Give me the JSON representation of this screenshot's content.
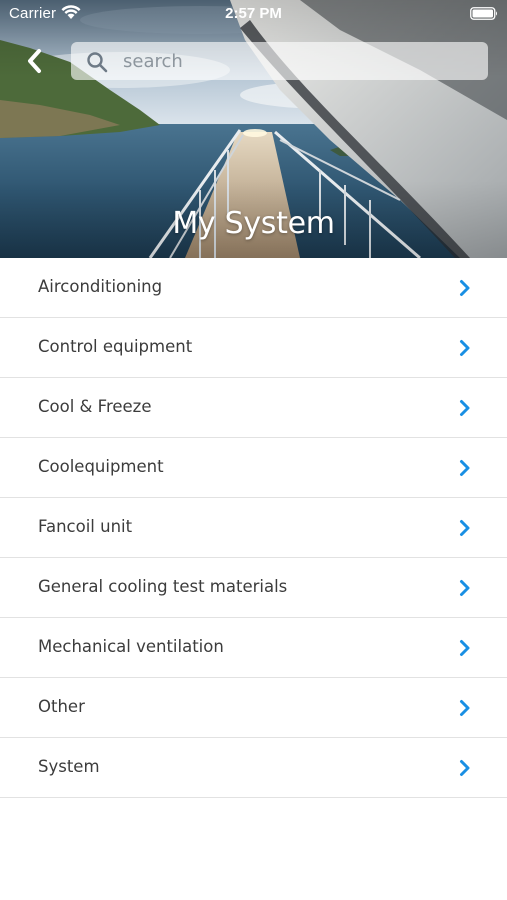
{
  "status_bar": {
    "carrier": "Carrier",
    "time": "2:57 PM",
    "icons": [
      "wifi-icon",
      "battery-icon"
    ]
  },
  "header": {
    "title": "My System",
    "back_icon": "chevron-left-icon",
    "search": {
      "placeholder": "search",
      "value": "",
      "icon": "search-icon"
    }
  },
  "categories": [
    {
      "label": "Airconditioning"
    },
    {
      "label": "Control equipment"
    },
    {
      "label": "Cool & Freeze"
    },
    {
      "label": "Coolequipment"
    },
    {
      "label": "Fancoil unit"
    },
    {
      "label": "General cooling test materials"
    },
    {
      "label": "Mechanical ventilation"
    },
    {
      "label": "Other"
    },
    {
      "label": "System"
    }
  ],
  "colors": {
    "accent": "#1a8fe3",
    "text": "#3c3c3c",
    "divider": "#e2e2e2",
    "background": "#ffffff"
  }
}
